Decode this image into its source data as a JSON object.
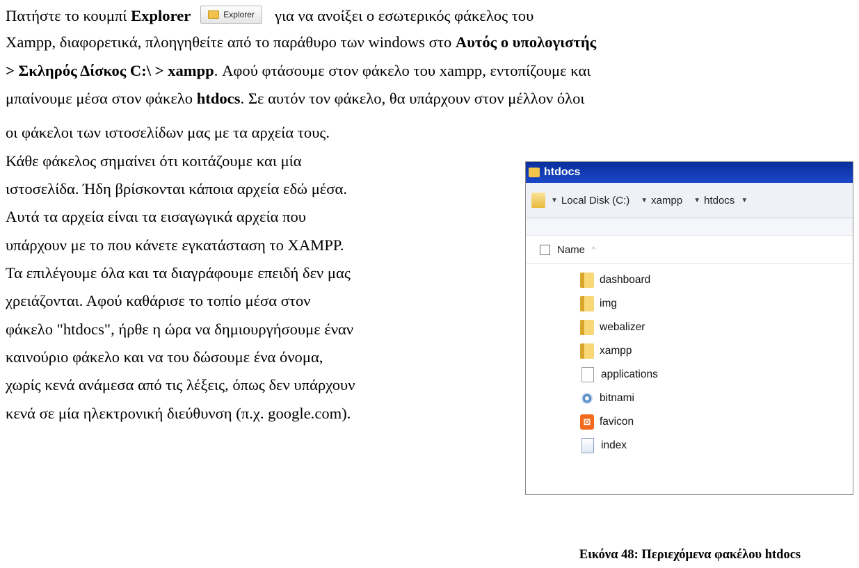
{
  "paragraph": {
    "l1_a": "Πατήστε το κουμπί ",
    "l1_b": "Explorer",
    "l1_c": "για να ανοίξει ο εσωτερικός φάκελος του",
    "explorer_button": "Explorer",
    "l2_a": "Xampp, διαφορετικά, πλοηγηθείτε από το παράθυρο των windows στο ",
    "l2_b": "Αυτός ο υπολογιστής",
    "l3_a": "> Σκληρός Δίσκος C:\\ > xampp",
    "l3_b": ". Αφού φτάσουμε στον φάκελο του xampp, εντοπίζουμε και",
    "l4_a": "μπαίνουμε μέσα στον φάκελο ",
    "l4_b": "htdocs",
    "l4_c": ". Σε αυτόν τον φάκελο, θα υπάρχουν στον μέλλον όλοι",
    "col": [
      "οι φάκελοι των ιστοσελίδων μας με τα αρχεία τους.",
      "Κάθε φάκελος σημαίνει ότι κοιτάζουμε και μία",
      "ιστοσελίδα. Ήδη βρίσκονται κάποια αρχεία εδώ μέσα.",
      "Αυτά τα αρχεία είναι τα εισαγωγικά αρχεία που",
      "υπάρχουν με το που κάνετε εγκατάσταση το XAMPP.",
      "Τα επιλέγουμε όλα και τα διαγράφουμε επειδή δεν μας",
      "χρειάζονται. Αφού καθάρισε το τοπίο μέσα στον",
      "φάκελο \"htdocs\", ήρθε η ώρα να δημιουργήσουμε έναν",
      "καινούριο φάκελο και να του δώσουμε ένα όνομα,",
      "χωρίς κενά ανάμεσα από τις λέξεις, όπως δεν υπάρχουν",
      "κενά σε μία ηλεκτρονική διεύθυνση (π.χ. google.com)."
    ]
  },
  "window": {
    "title": "htdocs",
    "breadcrumb": [
      "Local Disk (C:)",
      "xampp",
      "htdocs"
    ],
    "column_header": "Name",
    "items": [
      {
        "name": "dashboard",
        "icon": "folder-icon"
      },
      {
        "name": "img",
        "icon": "folder-icon"
      },
      {
        "name": "webalizer",
        "icon": "folder-icon"
      },
      {
        "name": "xampp",
        "icon": "folder-icon"
      },
      {
        "name": "applications",
        "icon": "file-icon"
      },
      {
        "name": "bitnami",
        "icon": "gear-icon"
      },
      {
        "name": "favicon",
        "icon": "xampp-icon"
      },
      {
        "name": "index",
        "icon": "document-icon"
      }
    ]
  },
  "caption": "Εικόνα 48: Περιεχόμενα φακέλου htdocs"
}
